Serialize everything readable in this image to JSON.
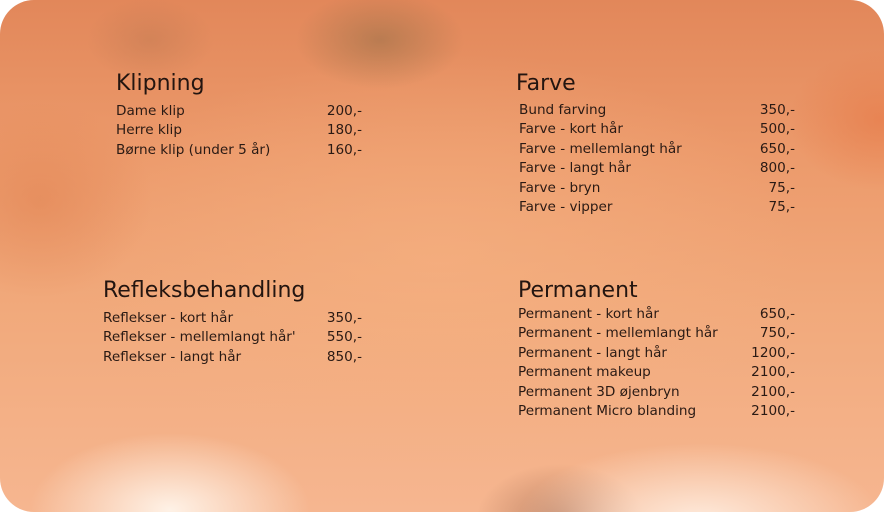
{
  "sections": {
    "klipning": {
      "title": "Klipning",
      "items": [
        {
          "name": "Dame klip",
          "price": "200,-"
        },
        {
          "name": "Herre klip",
          "price": "180,-"
        },
        {
          "name": "Børne klip (under 5 år)",
          "price": "160,-"
        }
      ]
    },
    "farve": {
      "title": "Farve",
      "items": [
        {
          "name": "Bund farving",
          "price": "350,-"
        },
        {
          "name": "Farve - kort hår",
          "price": "500,-"
        },
        {
          "name": "Farve - mellemlangt hår",
          "price": "650,-"
        },
        {
          "name": "Farve - langt hår",
          "price": "800,-"
        },
        {
          "name": "Farve - bryn",
          "price": "75,-"
        },
        {
          "name": "Farve - vipper",
          "price": "75,-"
        }
      ]
    },
    "refleksbehandling": {
      "title": "Refleksbehandling",
      "items": [
        {
          "name": "Reflekser - kort hår",
          "price": "350,-"
        },
        {
          "name": "Reflekser - mellemlangt hår'",
          "price": "550,-"
        },
        {
          "name": "Reflekser - langt hår",
          "price": "850,-"
        }
      ]
    },
    "permanent": {
      "title": "Permanent",
      "items": [
        {
          "name": "Permanent - kort hår",
          "price": "650,-"
        },
        {
          "name": "Permanent - mellemlangt hår",
          "price": "750,-"
        },
        {
          "name": "Permanent - langt hår",
          "price": "1200,-"
        },
        {
          "name": "Permanent makeup",
          "price": "2100,-"
        },
        {
          "name": "Permanent 3D øjenbryn",
          "price": "2100,-"
        },
        {
          "name": "Permanent Micro blanding",
          "price": "2100,-"
        }
      ]
    }
  }
}
